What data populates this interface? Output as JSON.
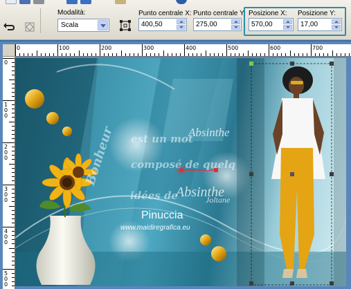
{
  "toolbar": {
    "mode_label": "Modalità:",
    "mode_value": "Scala",
    "center_x_label": "Punto centrale X:",
    "center_x_value": "400,50",
    "center_y_label": "Punto centrale Y:",
    "center_y_value": "275,00",
    "pos_x_label": "Posizione X:",
    "pos_x_value": "570,00",
    "pos_y_label": "Posizione Y:",
    "pos_y_value": "17,00"
  },
  "ruler": {
    "horizontal_labels": [
      "0",
      "100",
      "200",
      "300",
      "400",
      "500",
      "600",
      "700"
    ],
    "vertical_labels": [
      "0",
      "100",
      "200",
      "300",
      "400",
      "500"
    ]
  },
  "canvas": {
    "phrase_1": "est un mot",
    "phrase_2": "composé de quelq",
    "phrase_3": "idées de",
    "signature_1": "Absinthe",
    "signature_2": "Absinthe",
    "signature_3": "Joltane",
    "vertical_word": "Bonheur",
    "title": "Pinuccia",
    "url": "www.maidiregrafica.eu"
  },
  "colors": {
    "accent_highlight": "#2a8ea8",
    "dress_yellow": "#e5a413",
    "sunflower": "#f2b414",
    "handle_red": "#e0303c"
  }
}
